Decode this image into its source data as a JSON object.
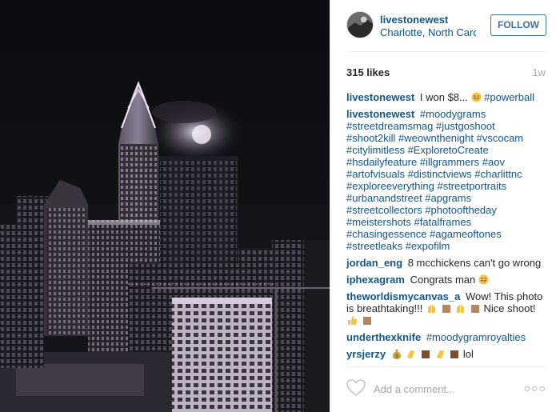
{
  "post": {
    "username": "livestonewest",
    "location": "Charlotte, North Carolina",
    "follow_label": "FOLLOW",
    "likes": "315 likes",
    "age": "1w"
  },
  "caption": {
    "user": "livestonewest",
    "text": "I won $8...",
    "tags": "#powerball"
  },
  "hashtag_comment": {
    "user": "livestonewest",
    "tags": "#moodygrams #streetdreamsmag #justgoshoot #shoot2kill #weownthenight #vscocam #citylimitless #ExploretoCreate #hsdailyfeature #illgrammers #aov #artofvisuals #distinctviews #charlittnc #exploreeverything #streetportraits #urbanandstreet #apgrams #streetcollectors #photooftheday #meistershots #fatalframes #chasingessence #agameoftones #streetleaks #expofilm"
  },
  "comments": [
    {
      "user": "jordan_eng",
      "text": "8 mcchickens can't go wrong"
    },
    {
      "user": "iphexagram",
      "text": "Congrats man"
    },
    {
      "user": "theworldismycanvas_a",
      "text_a": "Wow! This photo is breathtaking!!!",
      "text_b": "Nice shoot!"
    },
    {
      "user": "underthexknife",
      "tags": "#moodygramroyalties"
    },
    {
      "user": "yrsjerzy",
      "text": "lol"
    }
  ],
  "footer": {
    "add_comment_placeholder": "Add a comment...",
    "more_label": "○○○"
  },
  "colors": {
    "link_blue": "#125688",
    "follow_blue": "#3f729b",
    "muted_gray": "#a5a7aa"
  },
  "icons": [
    "avatar",
    "heart-icon",
    "more-options-icon",
    "grin-emoji",
    "clap-emoji",
    "money-bag-emoji"
  ]
}
